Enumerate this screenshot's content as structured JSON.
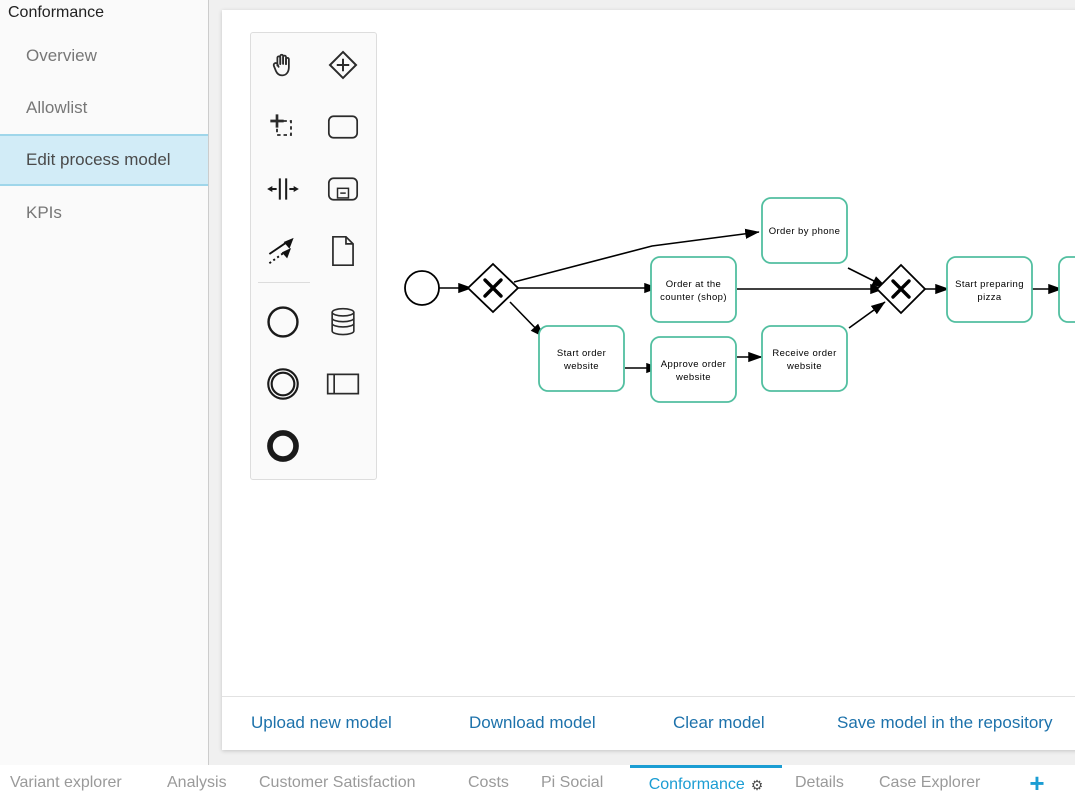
{
  "sidebar": {
    "title": "Conformance",
    "items": [
      {
        "label": "Overview",
        "selected": false
      },
      {
        "label": "Allowlist",
        "selected": false
      },
      {
        "label": "Edit process model",
        "selected": true
      },
      {
        "label": "KPIs",
        "selected": false
      }
    ]
  },
  "palette": {
    "tools": [
      {
        "name": "hand-tool-icon",
        "label": "Activate hand tool"
      },
      {
        "name": "gateway-icon",
        "label": "Create gateway"
      },
      {
        "name": "lasso-tool-icon",
        "label": "Activate lasso tool"
      },
      {
        "name": "task-icon",
        "label": "Create task"
      },
      {
        "name": "space-tool-icon",
        "label": "Activate create/remove space tool"
      },
      {
        "name": "subprocess-icon",
        "label": "Create expanded subprocess"
      },
      {
        "name": "connect-tool-icon",
        "label": "Activate global connect tool"
      },
      {
        "name": "data-object-icon",
        "label": "Create data object reference"
      },
      {
        "name": "start-event-icon",
        "label": "Create start event"
      },
      {
        "name": "data-store-icon",
        "label": "Create data store reference"
      },
      {
        "name": "intermediate-event-icon",
        "label": "Create intermediate/boundary event"
      },
      {
        "name": "pool-icon",
        "label": "Create pool/participant"
      },
      {
        "name": "end-event-icon",
        "label": "Create end event"
      }
    ]
  },
  "diagram": {
    "accent_color": "#52bfa0",
    "stroke_color": "#000000",
    "nodes": [
      {
        "id": "start",
        "type": "start-event",
        "label": ""
      },
      {
        "id": "gw1",
        "type": "exclusive-gateway",
        "label": ""
      },
      {
        "id": "t_phone",
        "type": "task",
        "label_lines": [
          "Order by phone"
        ]
      },
      {
        "id": "t_counter",
        "type": "task",
        "label_lines": [
          "Order at the",
          "counter (shop)"
        ]
      },
      {
        "id": "t_start_order",
        "type": "task",
        "label_lines": [
          "Start order",
          "website"
        ]
      },
      {
        "id": "t_approve",
        "type": "task",
        "label_lines": [
          "Approve order",
          "website"
        ]
      },
      {
        "id": "t_receive",
        "type": "task",
        "label_lines": [
          "Receive order",
          "website"
        ]
      },
      {
        "id": "gw2",
        "type": "exclusive-gateway",
        "label": ""
      },
      {
        "id": "t_prepare",
        "type": "task",
        "label_lines": [
          "Start preparing",
          "pizza"
        ]
      },
      {
        "id": "t_cut",
        "type": "task",
        "label_lines": [
          ""
        ]
      }
    ],
    "edges": [
      {
        "from": "start",
        "to": "gw1"
      },
      {
        "from": "gw1",
        "to": "t_phone"
      },
      {
        "from": "gw1",
        "to": "t_counter"
      },
      {
        "from": "gw1",
        "to": "t_start_order"
      },
      {
        "from": "t_start_order",
        "to": "t_approve"
      },
      {
        "from": "t_approve",
        "to": "t_receive"
      },
      {
        "from": "t_phone",
        "to": "gw2"
      },
      {
        "from": "t_counter",
        "to": "gw2"
      },
      {
        "from": "t_receive",
        "to": "gw2"
      },
      {
        "from": "gw2",
        "to": "t_prepare"
      },
      {
        "from": "t_prepare",
        "to": "t_cut"
      }
    ]
  },
  "actions": [
    {
      "label": "Upload new model"
    },
    {
      "label": "Download model"
    },
    {
      "label": "Clear model"
    },
    {
      "label": "Save model in the repository"
    }
  ],
  "tabs": [
    {
      "label": "Variant explorer",
      "active": false,
      "gear": false
    },
    {
      "label": "Analysis",
      "active": false,
      "gear": false
    },
    {
      "label": "Customer Satisfaction",
      "active": false,
      "gear": false
    },
    {
      "label": "Costs",
      "active": false,
      "gear": false
    },
    {
      "label": "Pi Social",
      "active": false,
      "gear": false
    },
    {
      "label": "Conformance",
      "active": true,
      "gear": true
    },
    {
      "label": "Details",
      "active": false,
      "gear": false
    },
    {
      "label": "Case Explorer",
      "active": false,
      "gear": false
    }
  ],
  "add_tab": {
    "label": "+",
    "icon": "plus-icon"
  },
  "colors": {
    "accent_blue": "#1b9dd3",
    "link_blue": "#1d72ab",
    "selected_bg": "#d2ecf7",
    "selected_border": "#9fd6ea",
    "task_stroke": "#52bfa0"
  }
}
